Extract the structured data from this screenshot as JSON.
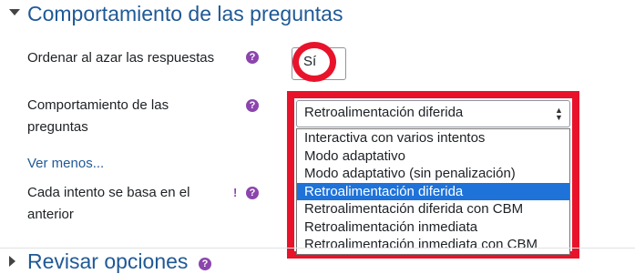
{
  "section": {
    "title": "Comportamiento de las preguntas"
  },
  "fields": {
    "shuffle": {
      "label": "Ordenar al azar las respuestas",
      "value": "Sí",
      "help_icon": "question-circle-icon"
    },
    "behaviour": {
      "label": "Comportamiento de las preguntas",
      "value": "Retroalimentación diferida",
      "help_icon": "question-circle-icon",
      "options": [
        "Interactiva con varios intentos",
        "Modo adaptativo",
        "Modo adaptativo (sin penalización)",
        "Retroalimentación diferida",
        "Retroalimentación diferida con CBM",
        "Retroalimentación inmediata",
        "Retroalimentación inmediata con CBM"
      ],
      "selected_index": 3
    },
    "show_less": "Ver menos...",
    "each_attempt": {
      "label": "Cada intento se basa en el anterior",
      "advanced_icon": "exclamation-icon",
      "help_icon": "question-circle-icon"
    }
  },
  "next_section": {
    "title": "Revisar opciones"
  },
  "colors": {
    "accent": "#1f5996",
    "help": "#8c45ad",
    "annotation": "#e8132b",
    "selection": "#1e72d8"
  }
}
